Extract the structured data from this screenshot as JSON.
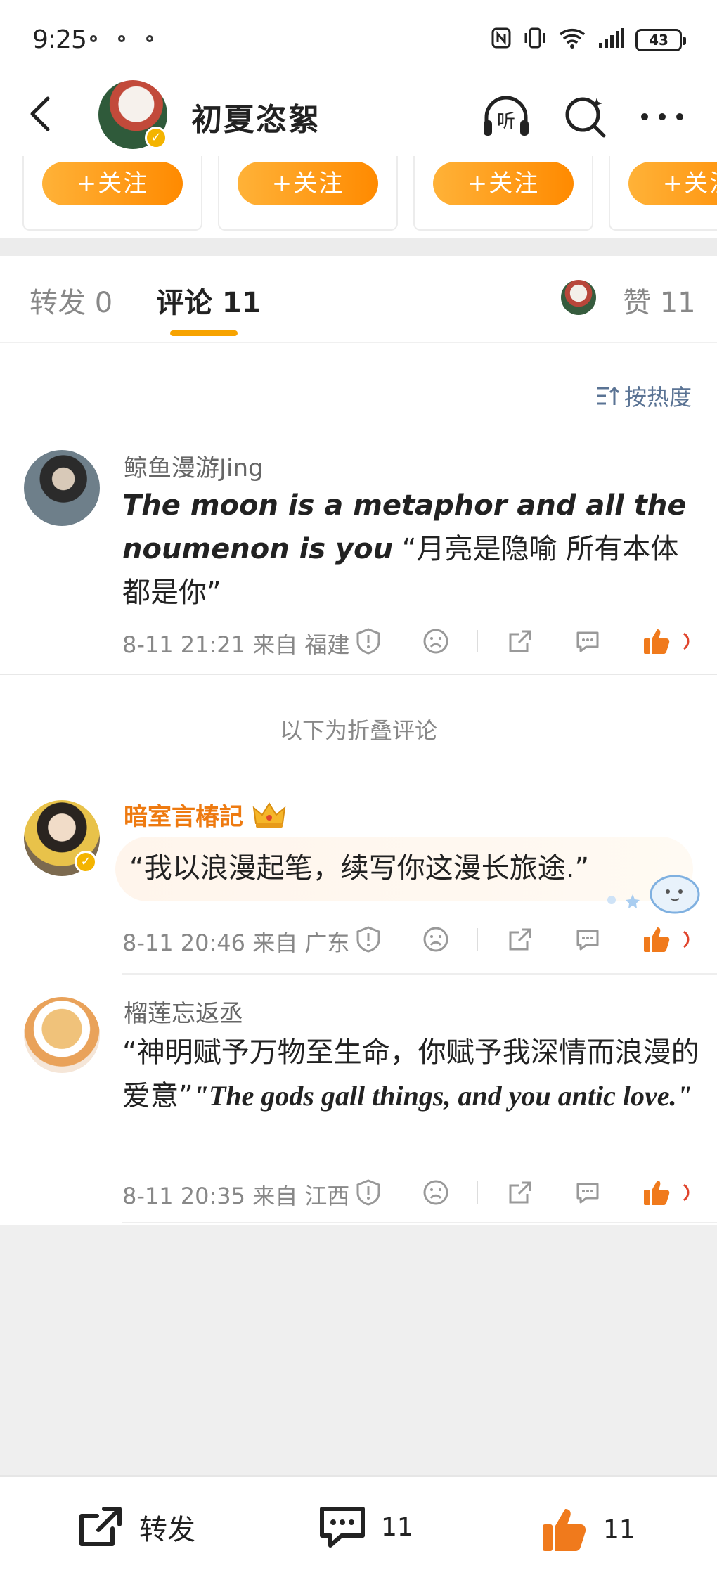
{
  "status_bar": {
    "time": "9:25",
    "battery": "43",
    "icons": [
      "nfc-icon",
      "vibrate-icon",
      "wifi-icon",
      "signal-icon",
      "battery-icon"
    ]
  },
  "header": {
    "username": "初夏恣絮",
    "listen_label": "听",
    "icons": [
      "back-arrow-icon",
      "verified-badge-icon",
      "listen-headphones-icon",
      "search-sparkle-icon",
      "more-icon"
    ]
  },
  "follow_cards": [
    {
      "label": "+关注"
    },
    {
      "label": "+关注"
    },
    {
      "label": "+关注"
    },
    {
      "label": "+关注"
    }
  ],
  "tabs": {
    "repost": "转发 0",
    "comments": "评论 11",
    "likes": "赞 11"
  },
  "sort_label": "按热度",
  "comments": [
    {
      "name": "鲸鱼漫游Jing",
      "text_en": "The moon is a metaphor  and all the noumenon is you",
      "text_zh": " “月亮是隐喻 所有本体都是你”",
      "meta": "8-11 21:21 来自 福建"
    },
    {
      "name": "暗室言椿記",
      "text": "“我以浪漫起笔，续写你这漫长旅途.”",
      "meta": "8-11 20:46 来自 广东"
    },
    {
      "name": "榴莲忘返丞",
      "text_zh": "“神明赋予万物至生命，你赋予我深情而浪漫的爱意”",
      "text_en": "\"The gods gall things, and you antic love.\"",
      "meta": "8-11 20:35 来自 江西"
    }
  ],
  "fold_note": "以下为折叠评论",
  "bottom_bar": {
    "repost_label": "转发",
    "comment_count": "11",
    "like_count": "11"
  },
  "colors": {
    "accent_orange": "#ff9a1a",
    "tab_underline": "#f7a300",
    "gold_name": "#ee7a10",
    "sort_blue": "#5a7394",
    "like_orange": "#f07a1c"
  }
}
